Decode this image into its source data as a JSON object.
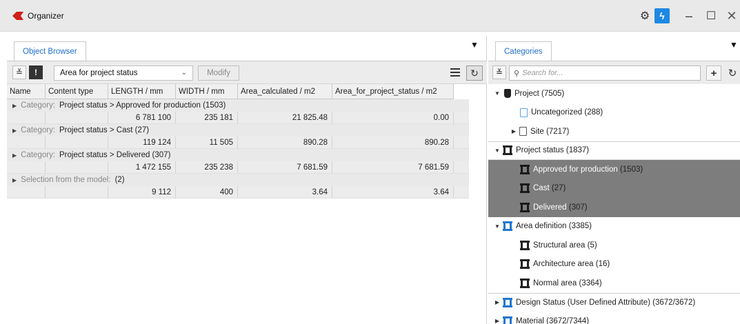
{
  "window": {
    "title": "Organizer"
  },
  "object_browser": {
    "tab_label": "Object Browser",
    "report_select": "Area for project status",
    "modify_label": "Modify",
    "columns": [
      "Name",
      "Content type",
      "LENGTH / mm",
      "WIDTH / mm",
      "Area_calculated / m2",
      "Area_for_project_status / m2"
    ],
    "groups": [
      {
        "prefix": "Category:",
        "title": "Project status > Approved for production (1503)",
        "length": "6 781 100",
        "width": "235 181",
        "area_calculated": "21 825.48",
        "area_for_project_status": "0.00"
      },
      {
        "prefix": "Category:",
        "title": "Project status > Cast (27)",
        "length": "119 124",
        "width": "11 505",
        "area_calculated": "890.28",
        "area_for_project_status": "890.28"
      },
      {
        "prefix": "Category:",
        "title": "Project status > Delivered (307)",
        "length": "1 472 155",
        "width": "235 238",
        "area_calculated": "7 681.59",
        "area_for_project_status": "7 681.59"
      },
      {
        "prefix": "Selection from the model:",
        "title": "(2)",
        "length": "9 112",
        "width": "400",
        "area_calculated": "3.64",
        "area_for_project_status": "3.64"
      }
    ]
  },
  "categories": {
    "tab_label": "Categories",
    "search_placeholder": "Search for...",
    "tree": [
      {
        "label": "Project",
        "count": "(7505)"
      },
      {
        "label": "Uncategorized",
        "count": "(288)"
      },
      {
        "label": "Site",
        "count": "(7217)"
      },
      {
        "label": "Project status",
        "count": "(1837)"
      },
      {
        "label": "Approved for production",
        "count": "(1503)"
      },
      {
        "label": "Cast",
        "count": "(27)"
      },
      {
        "label": "Delivered",
        "count": "(307)"
      },
      {
        "label": "Area definition",
        "count": "(3385)"
      },
      {
        "label": "Structural area",
        "count": "(5)"
      },
      {
        "label": "Architecture area",
        "count": "(16)"
      },
      {
        "label": "Normal area",
        "count": "(3364)"
      },
      {
        "label": "Design Status (User Defined Attribute)",
        "count": "(3672/3672)"
      },
      {
        "label": "Material",
        "count": "(3672/7344)"
      }
    ]
  }
}
